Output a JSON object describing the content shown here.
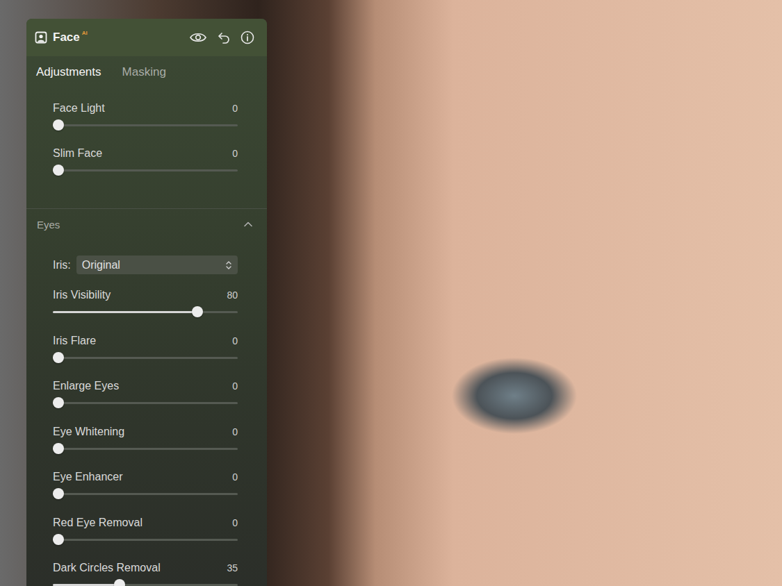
{
  "panel": {
    "title": "Face",
    "badge": "AI",
    "tabs": [
      {
        "label": "Adjustments",
        "selected": true
      },
      {
        "label": "Masking",
        "selected": false
      }
    ],
    "sliders": [
      {
        "label": "Face Light",
        "value": "0",
        "level": 0
      },
      {
        "label": "Slim Face",
        "value": "0",
        "level": 0
      }
    ],
    "sections": [
      {
        "title": "Eyes",
        "expanded": true,
        "iris": {
          "label": "Iris:",
          "value": "Original"
        },
        "sliders": [
          {
            "label": "Iris Visibility",
            "value": "80",
            "level": 0.8
          },
          {
            "label": "Iris Flare",
            "value": "0",
            "level": 0
          },
          {
            "label": "Enlarge Eyes",
            "value": "0",
            "level": 0
          },
          {
            "label": "Eye Whitening",
            "value": "0",
            "level": 0
          },
          {
            "label": "Eye Enhancer",
            "value": "0",
            "level": 0
          },
          {
            "label": "Red Eye Removal",
            "value": "0",
            "level": 0
          },
          {
            "label": "Dark Circles Removal",
            "value": "35",
            "level": 0.35
          }
        ]
      }
    ]
  }
}
